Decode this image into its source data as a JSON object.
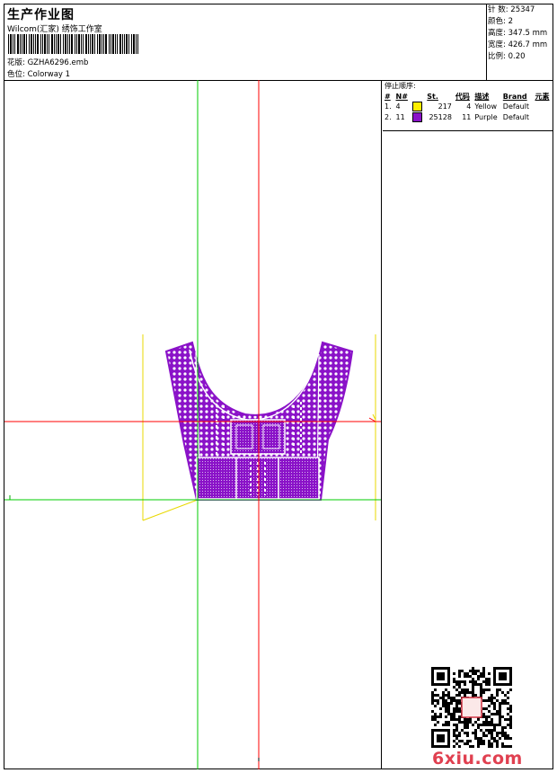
{
  "header": {
    "title": "生产作业图",
    "studio": "Wilcom(汇家) 绣饰工作室",
    "design_file_label": "花版:",
    "design_file": "GZHA6296.emb",
    "colorway_label": "色位:",
    "colorway": "Colorway 1"
  },
  "stats": [
    {
      "label": "针 数:",
      "value": "25347"
    },
    {
      "label": "颜色:",
      "value": "2"
    },
    {
      "label": "高度:",
      "value": "347.5 mm"
    },
    {
      "label": "宽度:",
      "value": "426.7 mm"
    },
    {
      "label": "比例:",
      "value": "0.20"
    }
  ],
  "legend": {
    "title": "停止顺序:",
    "headers": [
      "#",
      "N#",
      "",
      "St.",
      "代码",
      "描述",
      "Brand",
      "元素"
    ],
    "rows": [
      {
        "idx": "1.",
        "needle": "4",
        "color": "#ffee00",
        "stitches": "217",
        "code": "4",
        "desc": "Yellow",
        "brand": "Default"
      },
      {
        "idx": "2.",
        "needle": "11",
        "color": "#8a12c8",
        "stitches": "25128",
        "code": "11",
        "desc": "Purple",
        "brand": "Default"
      }
    ]
  },
  "colors": {
    "purple": "#8a12c8",
    "yellow": "#ffee00",
    "guide_red": "#ff0000",
    "guide_green": "#00cc00",
    "watermark": "#e04050"
  },
  "watermark": "6xiu.com"
}
